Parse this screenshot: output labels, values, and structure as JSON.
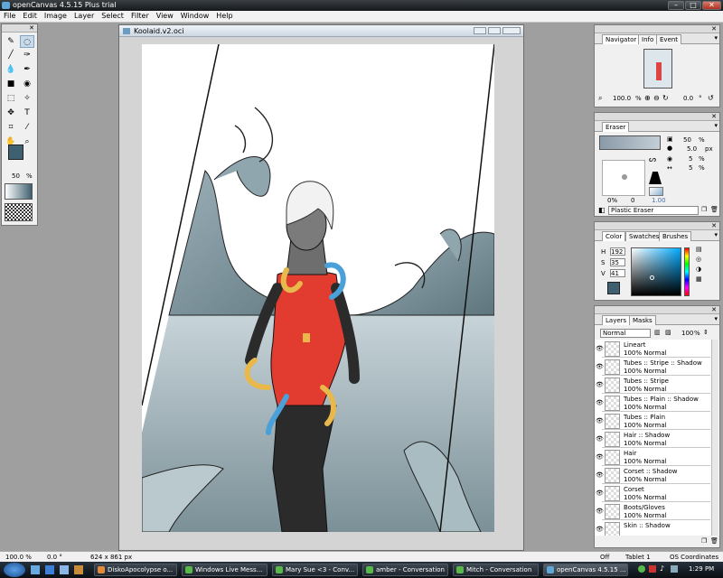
{
  "window": {
    "title": "openCanvas 4.5.15 Plus trial",
    "min": "–",
    "max": "□",
    "close": "✕"
  },
  "menu": [
    "File",
    "Edit",
    "Image",
    "Layer",
    "Select",
    "Filter",
    "View",
    "Window",
    "Help"
  ],
  "tools": {
    "size_value": "50",
    "size_unit": "%"
  },
  "document": {
    "title": "Koolaid.v2.oci"
  },
  "navigator": {
    "tabs": [
      "Navigator",
      "Info",
      "Event"
    ],
    "zoom": "100.0",
    "zoom_unit": "%",
    "rotation": "0.0",
    "rotation_unit": "°"
  },
  "eraser": {
    "tab": "Eraser",
    "size": "50",
    "size_unit": "%",
    "px_value": "5.0",
    "px_unit": "px",
    "val3": "5",
    "val3_unit": "%",
    "val4": "5",
    "val4_unit": "%",
    "left_pct": "0%",
    "left_small": "0",
    "right_val": "1.00",
    "name": "Plastic Eraser"
  },
  "color": {
    "tabs": [
      "Color",
      "Swatches",
      "Brushes"
    ],
    "h_label": "H",
    "h": "192",
    "s_label": "S",
    "s": "35",
    "v_label": "V",
    "v": "41",
    "current_color": "#3f6070"
  },
  "layers": {
    "tabs": [
      "Layers",
      "Masks"
    ],
    "mode": "Normal",
    "opacity": "100",
    "opacity_unit": "%",
    "items": [
      {
        "name": "Lineart",
        "mode": "100% Normal"
      },
      {
        "name": "Tubes :: Stripe :: Shadow",
        "mode": "100% Normal"
      },
      {
        "name": "Tubes :: Stripe",
        "mode": "100% Normal"
      },
      {
        "name": "Tubes :: Plain :: Shadow",
        "mode": "100% Normal"
      },
      {
        "name": "Tubes :: Plain",
        "mode": "100% Normal"
      },
      {
        "name": "Hair :: Shadow",
        "mode": "100% Normal"
      },
      {
        "name": "Hair",
        "mode": "100% Normal"
      },
      {
        "name": "Corset :: Shadow",
        "mode": "100% Normal"
      },
      {
        "name": "Corset",
        "mode": "100% Normal"
      },
      {
        "name": "Boots/Gloves",
        "mode": "100% Normal"
      },
      {
        "name": "Skin :: Shadow",
        "mode": ""
      }
    ]
  },
  "status": {
    "zoom": "100.0 %",
    "angle": "0.0 °",
    "dims": "624 x 861 px",
    "off": "Off",
    "tablet": "Tablet 1",
    "coords": "OS Coordinates"
  },
  "taskbar": {
    "items": [
      {
        "label": "DiskoApocolypse o..."
      },
      {
        "label": "Windows Live Mess..."
      },
      {
        "label": "Mary Sue <3 - Conv..."
      },
      {
        "label": "amber - Conversation"
      },
      {
        "label": "Mitch - Conversation"
      },
      {
        "label": "openCanvas 4.5.15 ..."
      }
    ],
    "clock": "1:29 PM"
  }
}
